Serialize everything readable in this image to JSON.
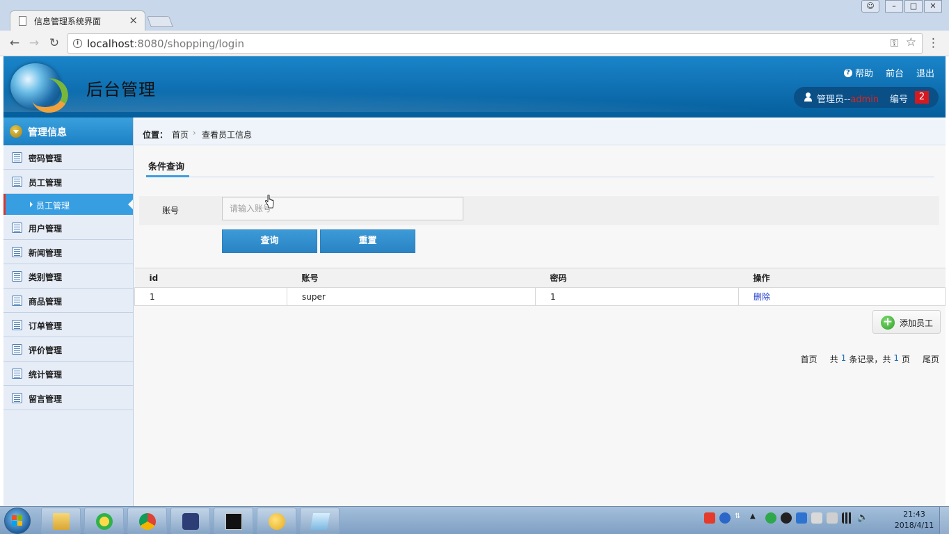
{
  "browser": {
    "tab_title": "信息管理系统界面",
    "tab_close": "×",
    "url_host": "localhost",
    "url_rest": ":8080/shopping/login",
    "window_buttons": [
      "user",
      "minimize",
      "maximize",
      "close"
    ]
  },
  "header": {
    "title": "后台管理",
    "help_label": "帮助",
    "front_label": "前台",
    "logout_label": "退出",
    "role_prefix": "管理员--",
    "username": "admin",
    "number_label": "编号",
    "number_value": "2"
  },
  "sidebar": {
    "header_label": "管理信息",
    "items": [
      {
        "label": "密码管理"
      },
      {
        "label": "员工管理"
      },
      {
        "label": "用户管理"
      },
      {
        "label": "新闻管理"
      },
      {
        "label": "类别管理"
      },
      {
        "label": "商品管理"
      },
      {
        "label": "订单管理"
      },
      {
        "label": "评价管理"
      },
      {
        "label": "统计管理"
      },
      {
        "label": "留言管理"
      }
    ],
    "sub_item": {
      "label": "员工管理",
      "parent": "员工管理"
    }
  },
  "breadcrumb": {
    "label": "位置：",
    "home": "首页",
    "separator": "›",
    "current": "查看员工信息"
  },
  "query": {
    "tab_label": "条件查询",
    "account_label": "账号",
    "account_placeholder": "请输入账号",
    "account_value": "",
    "search_button": "查询",
    "reset_button": "重置"
  },
  "table": {
    "headers": [
      "id",
      "账号",
      "密码",
      "操作"
    ],
    "rows": [
      {
        "id": "1",
        "account": "super",
        "password": "1",
        "action": "删除"
      }
    ]
  },
  "add_button": "添加员工",
  "pager": {
    "first": "首页",
    "total_prefix": "共",
    "total_records": "1",
    "records_suffix": "条记录，共",
    "total_pages": "1",
    "pages_suffix": "页",
    "last": "尾页"
  },
  "taskbar": {
    "apps": [
      "file-explorer",
      "qq-music",
      "chrome",
      "eclipse",
      "cmd",
      "paint-app",
      "notepad"
    ],
    "time": "21:43",
    "date": "2018/4/11"
  },
  "colors": {
    "header_blue": "#0b6db3",
    "sidebar_active": "#379ee2",
    "username_red": "#e2231a",
    "badge_red": "#d6191f",
    "link_blue": "#1d3bd0"
  }
}
